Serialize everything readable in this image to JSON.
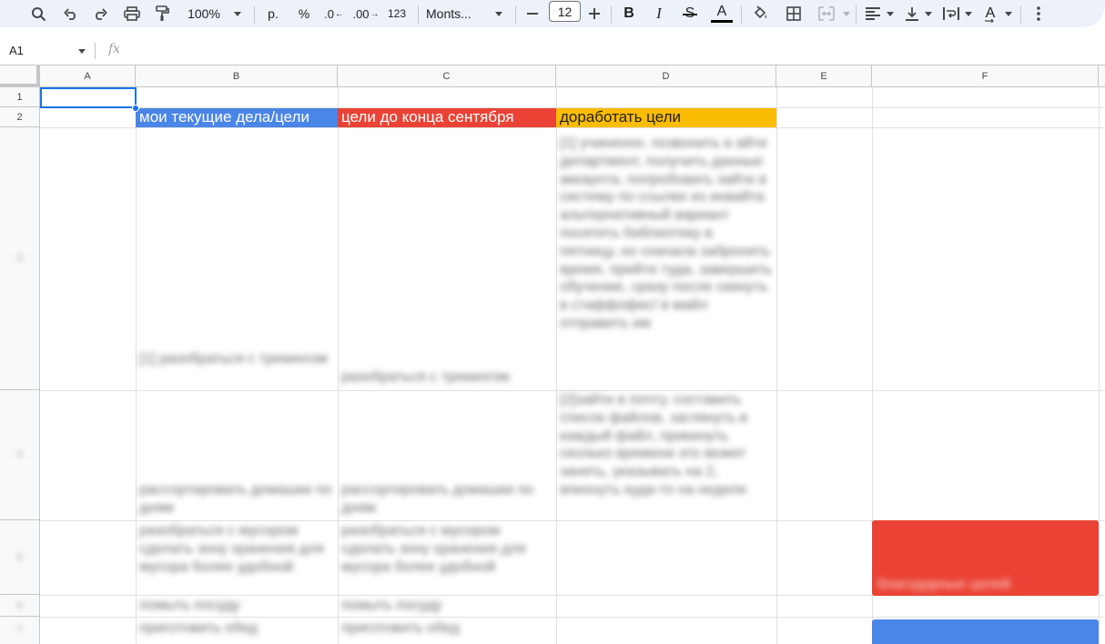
{
  "toolbar": {
    "zoom": "100%",
    "currency": "р.",
    "percent": "%",
    "decrease_decimals": ".0",
    "increase_decimals": ".00",
    "number_format": "123",
    "font": "Monts...",
    "font_size": "12",
    "text_color_letter": "A",
    "wrap_letter": "A",
    "icons": [
      "search-icon",
      "undo-icon",
      "redo-icon",
      "print-icon",
      "paint-format-icon",
      "minus-icon",
      "plus-icon",
      "bold-icon",
      "italic-icon",
      "strikethrough-icon",
      "text-color-icon",
      "fill-color-icon",
      "borders-icon",
      "merge-cells-icon",
      "align-left-icon",
      "valign-bottom-icon",
      "text-wrap-icon",
      "text-rotation-icon",
      "more-icon"
    ]
  },
  "formula_bar": {
    "name_box": "A1",
    "fx": "fx"
  },
  "grid": {
    "columns": [
      "A",
      "B",
      "C",
      "D",
      "E",
      "F"
    ],
    "rows": [
      "1",
      "2",
      "3",
      "4",
      "5",
      "6",
      "7"
    ],
    "headers": {
      "b2": "мои текущие дела/цели",
      "c2": "цели до конца сентября",
      "d2": "доработать цели"
    },
    "header_colors": {
      "b2": "#4a86e8",
      "c2": "#ea4335",
      "d2": "#fbbc04"
    },
    "blurred": {
      "b3": "[1] разобраться с трекингом",
      "c3": "разобраться с трекингом",
      "d3": "[1] учиненно, позвонить в айти департмент, получить данные аккаунта, попробовать зайти в систему по ссылке из инвайта альтернативный вариант посетить библиотеку в пятницу, но сначала забронить время, прийти туда, завершить обучение, сразу после скинуть в стаффофис/ в майл отправить им",
      "b4": "рассортировать домашки по дням",
      "c4": "рассортировать домашки по дням",
      "d4": "[2]зайти в почту, составить список файлов, заглянуть в каждый файл, прикинуть сколько времени это может занять, указывать на 2, впихнуть куда-то на неделе",
      "b5": "разобраться с мусором сделать зону хранения для мусора более удобной",
      "c5": "разобраться с мусором сделать зону хранения для мусора более удобной",
      "f5": "благодарные целей",
      "b6": "помыть посуду",
      "c6": "помыть посуду",
      "b7": "приготовить обед",
      "c7": "приготовить обед"
    },
    "block_colors": {
      "f5": "#ea4335",
      "f7": "#4a86e8"
    }
  }
}
